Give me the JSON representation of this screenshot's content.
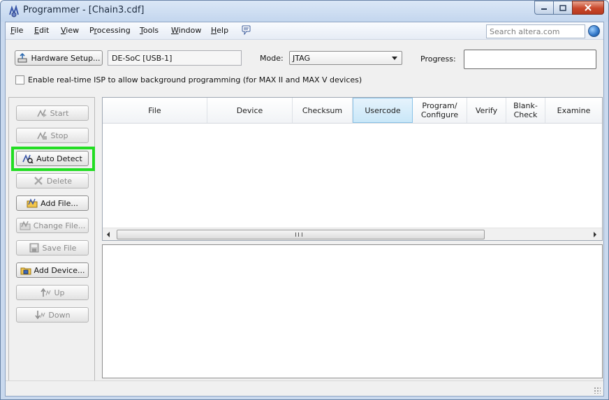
{
  "window": {
    "title": "Programmer - [Chain3.cdf]"
  },
  "menu": {
    "items": [
      {
        "pre": "",
        "ul": "F",
        "post": "ile"
      },
      {
        "pre": "",
        "ul": "E",
        "post": "dit"
      },
      {
        "pre": "",
        "ul": "V",
        "post": "iew"
      },
      {
        "pre": "P",
        "ul": "r",
        "post": "ocessing"
      },
      {
        "pre": "",
        "ul": "T",
        "post": "ools"
      },
      {
        "pre": "",
        "ul": "W",
        "post": "indow"
      },
      {
        "pre": "",
        "ul": "H",
        "post": "elp"
      }
    ],
    "search_placeholder": "Search altera.com"
  },
  "hardware": {
    "setup_label": "Hardware Setup...",
    "device": "DE-SoC [USB-1]",
    "mode_label": "Mode:",
    "mode_value": "JTAG",
    "progress_label": "Progress:",
    "isp_label": "Enable real-time ISP to allow background programming (for MAX II and MAX V devices)"
  },
  "buttons": {
    "start": "Start",
    "stop": "Stop",
    "auto_detect": "Auto Detect",
    "delete": "Delete",
    "add_file": "Add File...",
    "change_file": "Change File...",
    "save_file": "Save File",
    "add_device": "Add Device...",
    "up": "Up",
    "down": "Down"
  },
  "table": {
    "columns": [
      {
        "l1": "File",
        "l2": ""
      },
      {
        "l1": "Device",
        "l2": ""
      },
      {
        "l1": "Checksum",
        "l2": ""
      },
      {
        "l1": "Usercode",
        "l2": ""
      },
      {
        "l1": "Program/",
        "l2": "Configure"
      },
      {
        "l1": "Verify",
        "l2": ""
      },
      {
        "l1": "Blank-",
        "l2": "Check"
      },
      {
        "l1": "Examine",
        "l2": ""
      }
    ]
  },
  "colors": {
    "highlight": "#22dd22",
    "selected_column": "#c9e7f8"
  }
}
